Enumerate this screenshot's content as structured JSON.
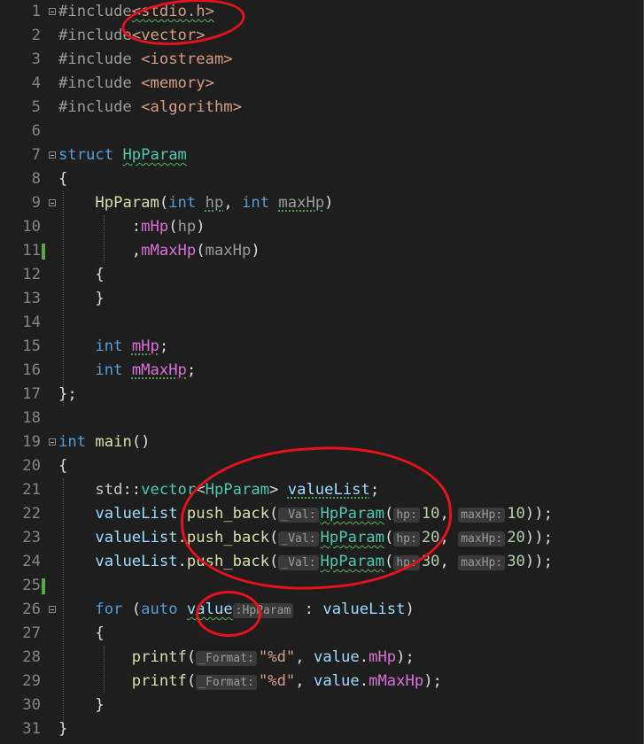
{
  "editor": {
    "lines": [
      {
        "n": "1",
        "fold": true,
        "tokens": [
          {
            "t": "#include",
            "c": "pp"
          },
          {
            "t": "<stdio.h>",
            "c": "inc",
            "sq": true
          }
        ]
      },
      {
        "n": "2",
        "tokens": [
          {
            "t": "#include",
            "c": "pp"
          },
          {
            "t": "<vector>",
            "c": "inc"
          }
        ]
      },
      {
        "n": "3",
        "tokens": [
          {
            "t": "#include",
            "c": "pp"
          },
          {
            "t": " "
          },
          {
            "t": "<iostream>",
            "c": "inc"
          }
        ]
      },
      {
        "n": "4",
        "tokens": [
          {
            "t": "#include",
            "c": "pp"
          },
          {
            "t": " "
          },
          {
            "t": "<memory>",
            "c": "inc"
          }
        ]
      },
      {
        "n": "5",
        "tokens": [
          {
            "t": "#include",
            "c": "pp"
          },
          {
            "t": " "
          },
          {
            "t": "<algorithm>",
            "c": "inc"
          }
        ]
      },
      {
        "n": "6",
        "tokens": []
      },
      {
        "n": "7",
        "fold": true,
        "tokens": [
          {
            "t": "struct",
            "c": "kw"
          },
          {
            "t": " "
          },
          {
            "t": "HpParam",
            "c": "type",
            "sq": true
          }
        ]
      },
      {
        "n": "8",
        "tokens": [
          {
            "t": "{",
            "c": "punc"
          }
        ]
      },
      {
        "n": "9",
        "fold": true,
        "tokens": [
          {
            "t": "    "
          },
          {
            "t": "HpParam",
            "c": "fn"
          },
          {
            "t": "(",
            "c": "punc"
          },
          {
            "t": "int",
            "c": "kw"
          },
          {
            "t": " "
          },
          {
            "t": "hp",
            "c": "par",
            "dot": true
          },
          {
            "t": ", ",
            "c": "punc"
          },
          {
            "t": "int",
            "c": "kw"
          },
          {
            "t": " "
          },
          {
            "t": "maxHp",
            "c": "par",
            "dot": true
          },
          {
            "t": ")",
            "c": "punc"
          }
        ]
      },
      {
        "n": "10",
        "tokens": [
          {
            "t": "        "
          },
          {
            "t": ":",
            "c": "punc"
          },
          {
            "t": "mHp",
            "c": "mem"
          },
          {
            "t": "(",
            "c": "punc"
          },
          {
            "t": "hp",
            "c": "par"
          },
          {
            "t": ")",
            "c": "punc"
          }
        ]
      },
      {
        "n": "11",
        "changed": true,
        "tokens": [
          {
            "t": "        "
          },
          {
            "t": ",",
            "c": "punc"
          },
          {
            "t": "mMaxHp",
            "c": "mem"
          },
          {
            "t": "(",
            "c": "punc"
          },
          {
            "t": "maxHp",
            "c": "par"
          },
          {
            "t": ")",
            "c": "punc"
          }
        ]
      },
      {
        "n": "12",
        "tokens": [
          {
            "t": "    "
          },
          {
            "t": "{",
            "c": "punc"
          }
        ]
      },
      {
        "n": "13",
        "tokens": [
          {
            "t": "    "
          },
          {
            "t": "}",
            "c": "punc"
          }
        ]
      },
      {
        "n": "14",
        "tokens": []
      },
      {
        "n": "15",
        "tokens": [
          {
            "t": "    "
          },
          {
            "t": "int",
            "c": "kw"
          },
          {
            "t": " "
          },
          {
            "t": "mHp",
            "c": "mem",
            "dot": true
          },
          {
            "t": ";",
            "c": "punc"
          }
        ]
      },
      {
        "n": "16",
        "tokens": [
          {
            "t": "    "
          },
          {
            "t": "int",
            "c": "kw"
          },
          {
            "t": " "
          },
          {
            "t": "mMaxHp",
            "c": "mem",
            "dot": true
          },
          {
            "t": ";",
            "c": "punc"
          }
        ]
      },
      {
        "n": "17",
        "tokens": [
          {
            "t": "};",
            "c": "punc"
          }
        ]
      },
      {
        "n": "18",
        "tokens": []
      },
      {
        "n": "19",
        "fold": true,
        "tokens": [
          {
            "t": "int",
            "c": "kw"
          },
          {
            "t": " "
          },
          {
            "t": "main",
            "c": "fn"
          },
          {
            "t": "()",
            "c": "punc"
          }
        ]
      },
      {
        "n": "20",
        "tokens": [
          {
            "t": "{",
            "c": "punc"
          }
        ]
      },
      {
        "n": "21",
        "tokens": [
          {
            "t": "    "
          },
          {
            "t": "std",
            "c": "ns"
          },
          {
            "t": "::",
            "c": "punc"
          },
          {
            "t": "vector",
            "c": "type"
          },
          {
            "t": "<",
            "c": "punc"
          },
          {
            "t": "HpParam",
            "c": "type"
          },
          {
            "t": "> ",
            "c": "punc"
          },
          {
            "t": "valueList",
            "c": "var",
            "dot": true
          },
          {
            "t": ";",
            "c": "punc"
          }
        ]
      },
      {
        "n": "22",
        "tokens": [
          {
            "t": "    "
          },
          {
            "t": "valueList",
            "c": "var"
          },
          {
            "t": ".",
            "c": "punc"
          },
          {
            "t": "push_back",
            "c": "fn"
          },
          {
            "t": "(",
            "c": "punc"
          },
          {
            "t": "_Val:",
            "hint": true
          },
          {
            "t": "HpParam",
            "c": "type",
            "sq": true
          },
          {
            "t": "(",
            "c": "punc"
          },
          {
            "t": "hp:",
            "hint": true
          },
          {
            "t": "10",
            "c": "num"
          },
          {
            "t": ", ",
            "c": "punc"
          },
          {
            "t": "maxHp:",
            "hint": true
          },
          {
            "t": "10",
            "c": "num"
          },
          {
            "t": "));",
            "c": "punc"
          }
        ]
      },
      {
        "n": "23",
        "tokens": [
          {
            "t": "    "
          },
          {
            "t": "valueList",
            "c": "var"
          },
          {
            "t": ".",
            "c": "punc"
          },
          {
            "t": "push_back",
            "c": "fn"
          },
          {
            "t": "(",
            "c": "punc"
          },
          {
            "t": "_Val:",
            "hint": true
          },
          {
            "t": "HpParam",
            "c": "type",
            "sq": true
          },
          {
            "t": "(",
            "c": "punc"
          },
          {
            "t": "hp:",
            "hint": true
          },
          {
            "t": "20",
            "c": "num"
          },
          {
            "t": ", ",
            "c": "punc"
          },
          {
            "t": "maxHp:",
            "hint": true
          },
          {
            "t": "20",
            "c": "num"
          },
          {
            "t": "));",
            "c": "punc"
          }
        ]
      },
      {
        "n": "24",
        "tokens": [
          {
            "t": "    "
          },
          {
            "t": "valueList",
            "c": "var"
          },
          {
            "t": ".",
            "c": "punc"
          },
          {
            "t": "push_back",
            "c": "fn"
          },
          {
            "t": "(",
            "c": "punc"
          },
          {
            "t": "_Val:",
            "hint": true
          },
          {
            "t": "HpParam",
            "c": "type",
            "sq": true
          },
          {
            "t": "(",
            "c": "punc"
          },
          {
            "t": "hp:",
            "hint": true
          },
          {
            "t": "30",
            "c": "num"
          },
          {
            "t": ", ",
            "c": "punc"
          },
          {
            "t": "maxHp:",
            "hint": true
          },
          {
            "t": "30",
            "c": "num"
          },
          {
            "t": "));",
            "c": "punc"
          }
        ]
      },
      {
        "n": "25",
        "changed": true,
        "tokens": []
      },
      {
        "n": "26",
        "fold": true,
        "tokens": [
          {
            "t": "    "
          },
          {
            "t": "for",
            "c": "kw"
          },
          {
            "t": " (",
            "c": "punc"
          },
          {
            "t": "auto",
            "c": "kw"
          },
          {
            "t": " "
          },
          {
            "t": "value",
            "c": "var",
            "sq": true
          },
          {
            "t": ":HpParam",
            "hint": true
          },
          {
            "t": " : ",
            "c": "punc"
          },
          {
            "t": "valueList",
            "c": "var"
          },
          {
            "t": ")",
            "c": "punc"
          }
        ]
      },
      {
        "n": "27",
        "tokens": [
          {
            "t": "    "
          },
          {
            "t": "{",
            "c": "punc"
          }
        ]
      },
      {
        "n": "28",
        "tokens": [
          {
            "t": "        "
          },
          {
            "t": "printf",
            "c": "fn"
          },
          {
            "t": "(",
            "c": "punc"
          },
          {
            "t": "_Format:",
            "hint": true
          },
          {
            "t": "\"%d\"",
            "c": "str"
          },
          {
            "t": ", ",
            "c": "punc"
          },
          {
            "t": "value",
            "c": "var"
          },
          {
            "t": ".",
            "c": "punc"
          },
          {
            "t": "mHp",
            "c": "mem"
          },
          {
            "t": ");",
            "c": "punc"
          }
        ]
      },
      {
        "n": "29",
        "tokens": [
          {
            "t": "        "
          },
          {
            "t": "printf",
            "c": "fn"
          },
          {
            "t": "(",
            "c": "punc"
          },
          {
            "t": "_Format:",
            "hint": true
          },
          {
            "t": "\"%d\"",
            "c": "str"
          },
          {
            "t": ", ",
            "c": "punc"
          },
          {
            "t": "value",
            "c": "var"
          },
          {
            "t": ".",
            "c": "punc"
          },
          {
            "t": "mMaxHp",
            "c": "mem"
          },
          {
            "t": ");",
            "c": "punc"
          }
        ]
      },
      {
        "n": "30",
        "tokens": [
          {
            "t": "    "
          },
          {
            "t": "}",
            "c": "punc"
          }
        ]
      },
      {
        "n": "31",
        "tokens": [
          {
            "t": "}",
            "c": "punc"
          }
        ]
      }
    ]
  },
  "colors": {
    "background": "#1e1e1e",
    "annotation": "#e8101a",
    "change_marker": "#57a64a"
  }
}
